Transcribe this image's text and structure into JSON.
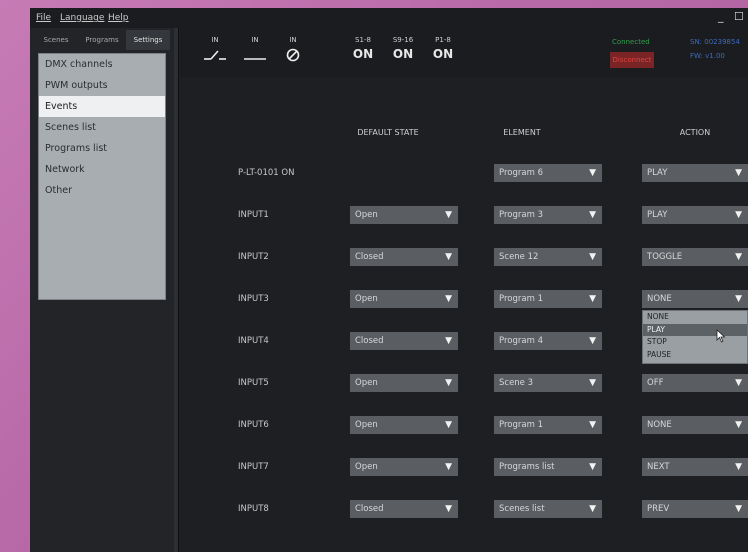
{
  "menubar": {
    "file": "File",
    "language": "Language",
    "help": "Help",
    "minimize": "_",
    "maximize": "☐"
  },
  "tabs": [
    "Scenes",
    "Programs",
    "Settings"
  ],
  "nav": {
    "items": [
      "DMX channels",
      "PWM outputs",
      "Events",
      "Scenes list",
      "Programs list",
      "Network",
      "Other"
    ],
    "active_index": 2
  },
  "status": {
    "inputs": [
      {
        "label": "IN",
        "icon": "switch-open-icon"
      },
      {
        "label": "IN",
        "icon": "switch-closed-icon"
      },
      {
        "label": "IN",
        "icon": "disabled-icon"
      }
    ],
    "groups": [
      {
        "label": "S1-8",
        "value": "ON"
      },
      {
        "label": "S9-16",
        "value": "ON"
      },
      {
        "label": "P1-8",
        "value": "ON"
      }
    ],
    "connected": "Connected",
    "disconnect": "Disconnect",
    "info1": "SN: 00239854",
    "info2": "FW: v1.00"
  },
  "columns": {
    "default_state": "DEFAULT STATE",
    "element": "ELEMENT",
    "action": "ACTION"
  },
  "rows": [
    {
      "label": "P-LT-0101 ON",
      "state": null,
      "element": "Program 6",
      "action": "PLAY"
    },
    {
      "label": "INPUT1",
      "state": "Open",
      "element": "Program 3",
      "action": "PLAY"
    },
    {
      "label": "INPUT2",
      "state": "Closed",
      "element": "Scene 12",
      "action": "TOGGLE"
    },
    {
      "label": "INPUT3",
      "state": "Open",
      "element": "Program 1",
      "action": "NONE"
    },
    {
      "label": "INPUT4",
      "state": "Closed",
      "element": "Program 4",
      "action": ""
    },
    {
      "label": "INPUT5",
      "state": "Open",
      "element": "Scene 3",
      "action": "OFF"
    },
    {
      "label": "INPUT6",
      "state": "Open",
      "element": "Program 1",
      "action": "NONE"
    },
    {
      "label": "INPUT7",
      "state": "Open",
      "element": "Programs list",
      "action": "NEXT"
    },
    {
      "label": "INPUT8",
      "state": "Closed",
      "element": "Scenes list",
      "action": "PREV"
    }
  ],
  "open_menu": {
    "options": [
      "NONE",
      "PLAY",
      "STOP",
      "PAUSE"
    ],
    "highlighted_index": 1
  },
  "arrow_glyph": "▼",
  "colors": {
    "window_bg": "#1d1f22",
    "dropdown_bg": "#5a5e63",
    "connected": "#2f9e4a",
    "disconnect": "#7a2425",
    "info": "#3b6bbd"
  }
}
